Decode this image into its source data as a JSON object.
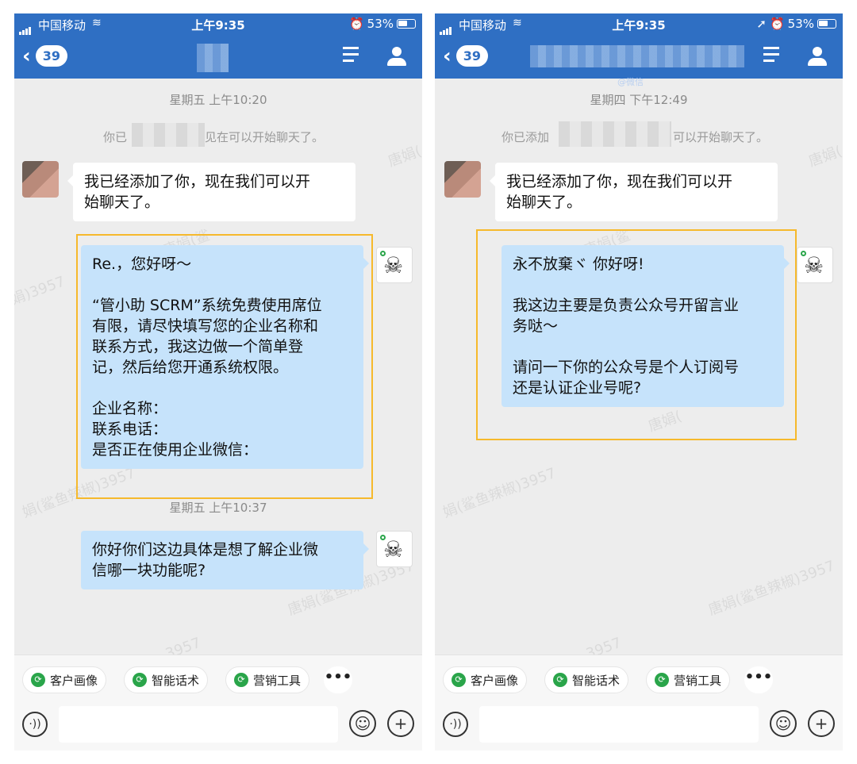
{
  "phones": [
    {
      "status": {
        "carrier": "中国移动",
        "time": "上午9:35",
        "battery": "53%",
        "alarm": "⏰",
        "location": ""
      },
      "nav": {
        "back_count": "39",
        "subtitle": ""
      },
      "timestamps": [
        "星期五 上午10:20",
        "星期五 上午10:37"
      ],
      "system_text_left": "你已",
      "system_text_right": "见在可以开始聊天了。",
      "messages": [
        {
          "text": "我已经添加了你，现在我们可以开\n始聊天了。"
        },
        {
          "text": "Re.，您好呀～\n\n“管小助 SCRM”系统免费使用席位\n有限，请尽快填写您的企业名称和\n联系方式，我这边做一个简单登\n记，然后给您开通系统权限。\n\n企业名称：\n联系电话：\n是否正在使用企业微信："
        },
        {
          "text": "你好你们这边具体是想了解企业微\n信哪一块功能呢?"
        }
      ],
      "watermarks": [
        "唐娟(",
        "唐娟(鲨",
        "娟)3957",
        "娟(鲨鱼辣椒)3957",
        "唐娟(鲨鱼辣椒)3957",
        "3957"
      ],
      "chips": [
        "客户画像",
        "智能话术",
        "营销工具"
      ],
      "more": "•••",
      "emoji_icon": "☺",
      "plus_icon": "+",
      "voice_icon": "·))"
    },
    {
      "status": {
        "carrier": "中国移动",
        "time": "上午9:35",
        "battery": "53%",
        "alarm": "⏰",
        "location": "➚"
      },
      "nav": {
        "back_count": "39",
        "subtitle": "@微信"
      },
      "timestamps": [
        "星期四 下午12:49"
      ],
      "system_text_left": "你已添加",
      "system_text_right": "可以开始聊天了。",
      "messages": [
        {
          "text": "我已经添加了你，现在我们可以开\n始聊天了。"
        },
        {
          "text": "永不放棄ヾ 你好呀!\n\n我这边主要是负责公众号开留言业\n务哒～\n\n请问一下你的公众号是个人订阅号\n还是认证企业号呢?"
        }
      ],
      "watermarks": [
        "唐娟(",
        "唐娟(鲨",
        "娟(鲨鱼辣椒)3957",
        "唐娟(鲨鱼辣椒)3957",
        "唐娟(",
        "3957"
      ],
      "chips": [
        "客户画像",
        "智能话术",
        "营销工具"
      ],
      "more": "•••",
      "emoji_icon": "☺",
      "plus_icon": "+",
      "voice_icon": "·))"
    }
  ]
}
